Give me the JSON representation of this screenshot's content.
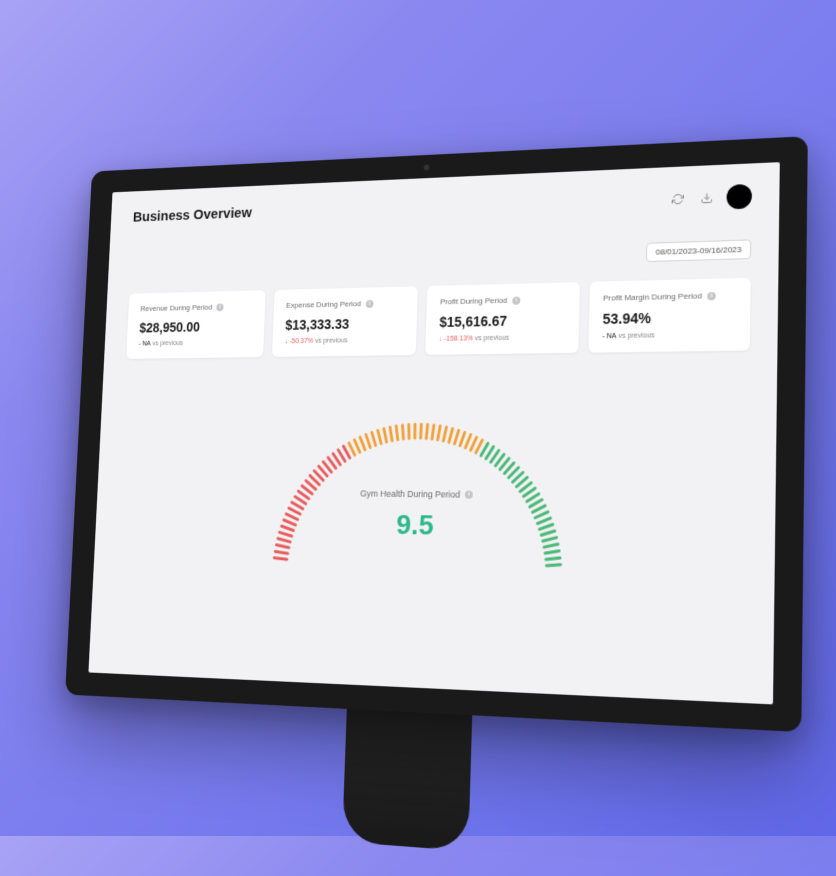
{
  "page_title": "Business Overview",
  "header": {
    "avatar_text": "",
    "date_range": "08/01/2023-09/16/2023"
  },
  "metrics": [
    {
      "label": "Revenue During Period",
      "value": "$28,950.00",
      "delta": "- NA",
      "delta_type": "neutral",
      "compare_suffix": "vs previous"
    },
    {
      "label": "Expense During Period",
      "value": "$13,333.33",
      "delta": "↓ -50.37%",
      "delta_type": "negative",
      "compare_suffix": "vs previous"
    },
    {
      "label": "Profit During Period",
      "value": "$15,616.67",
      "delta": "↓ -158.13%",
      "delta_type": "negative",
      "compare_suffix": "vs previous"
    },
    {
      "label": "Profit Margin During Period",
      "value": "53.94%",
      "delta": "- NA",
      "delta_type": "neutral",
      "compare_suffix": "vs previous"
    }
  ],
  "gauge": {
    "label": "Gym Health During Period",
    "value": "9.5"
  },
  "chart_data": {
    "type": "gauge",
    "title": "Gym Health During Period",
    "value": 9.5,
    "range": [
      0,
      10
    ],
    "segments": [
      {
        "from": 0,
        "to": 3.3,
        "color": "#e85d5d"
      },
      {
        "from": 3.3,
        "to": 6.6,
        "color": "#f0a13a"
      },
      {
        "from": 6.6,
        "to": 10,
        "color": "#4bb977"
      }
    ]
  }
}
